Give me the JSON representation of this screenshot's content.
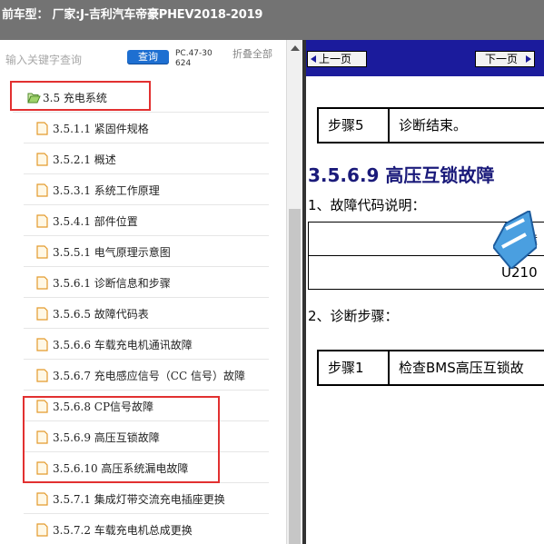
{
  "window": {
    "title": "前车型： 厂家:J-吉利汽车帝豪PHEV2018-2019"
  },
  "sidebar": {
    "search_placeholder": "输入关键字查询",
    "search_button": "查询",
    "doc_code": "PC.47-30624",
    "collapse_all": "折叠全部",
    "items": [
      {
        "label": "3.5 充电系统",
        "type": "folder",
        "highlighted": true
      },
      {
        "label": "3.5.1.1 紧固件规格",
        "type": "doc"
      },
      {
        "label": "3.5.2.1 概述",
        "type": "doc"
      },
      {
        "label": "3.5.3.1 系统工作原理",
        "type": "doc"
      },
      {
        "label": "3.5.4.1 部件位置",
        "type": "doc"
      },
      {
        "label": "3.5.5.1 电气原理示意图",
        "type": "doc"
      },
      {
        "label": "3.5.6.1 诊断信息和步骤",
        "type": "doc"
      },
      {
        "label": "3.5.6.5 故障代码表",
        "type": "doc"
      },
      {
        "label": "3.5.6.6 车载充电机通讯故障",
        "type": "doc"
      },
      {
        "label": "3.5.6.7 充电感应信号（CC 信号）故障",
        "type": "doc"
      },
      {
        "label": "3.5.6.8 CP信号故障",
        "type": "doc",
        "highlighted": true
      },
      {
        "label": "3.5.6.9 高压互锁故障",
        "type": "doc",
        "highlighted": true
      },
      {
        "label": "3.5.6.10 高压系统漏电故障",
        "type": "doc",
        "highlighted": true
      },
      {
        "label": "3.5.7.1 集成灯带交流充电插座更换",
        "type": "doc"
      },
      {
        "label": "3.5.7.2 车载充电机总成更换",
        "type": "doc"
      }
    ]
  },
  "viewer": {
    "prev_page": "上一页",
    "next_page": "下一页",
    "step5_label": "步骤5",
    "step5_text": "诊断结束。",
    "section_title": "3.5.6.9 高压互锁故障",
    "dtc_heading": "1、故障代码说明：",
    "dtc_header_partial": "故障",
    "dtc_code_partial": "U210",
    "diag_heading": "2、诊断步骤：",
    "step1_label": "步骤1",
    "step1_text": "检查BMS高压互锁故"
  },
  "colors": {
    "title_bar": "#737373",
    "nav_bar": "#1b1b9c",
    "search_button": "#1e6fd1",
    "highlight_box": "#e23030",
    "section_title": "#1a1a7a"
  }
}
